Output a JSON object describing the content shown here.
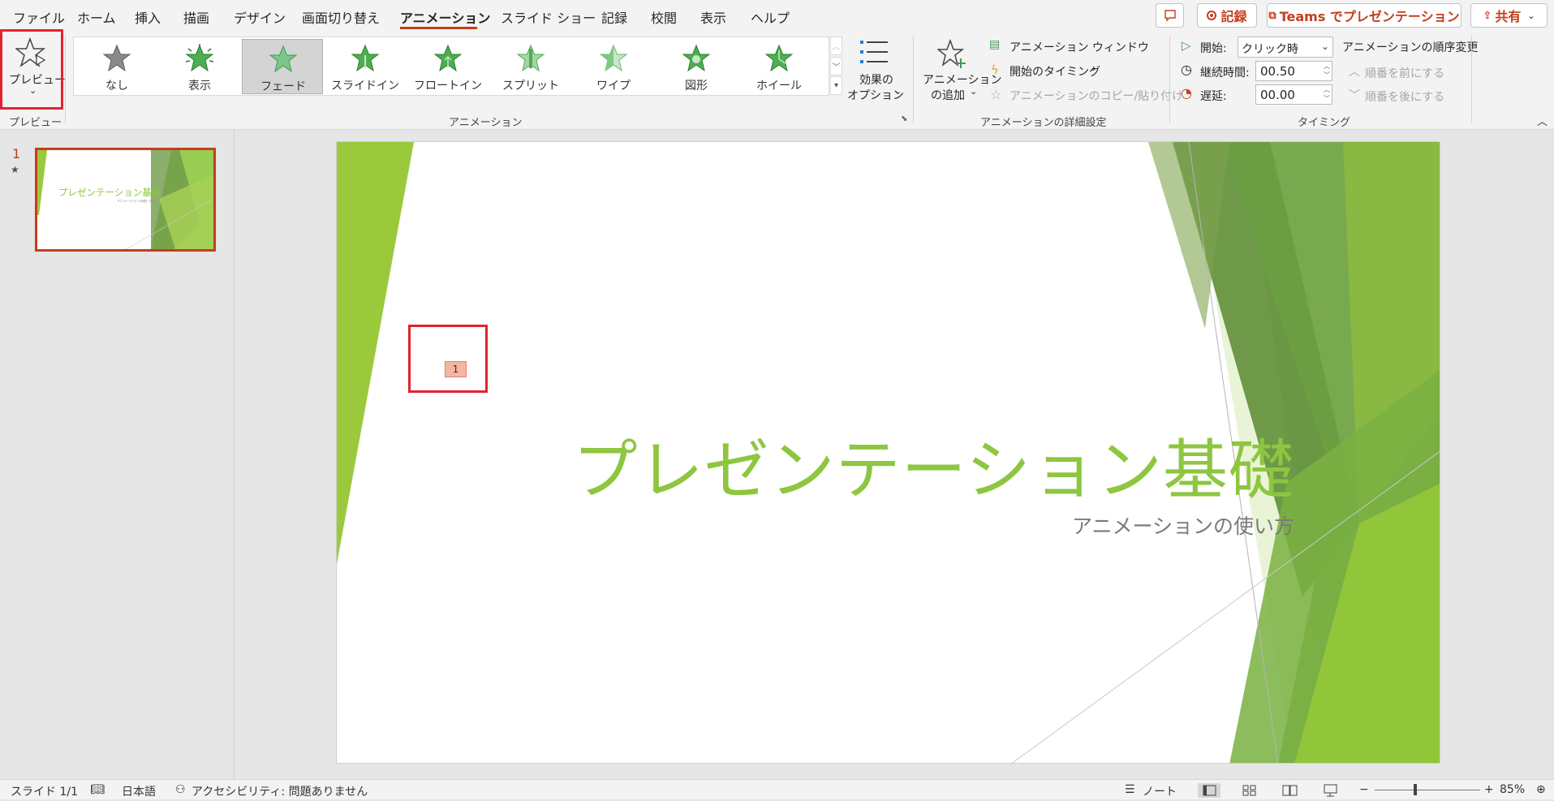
{
  "menu": {
    "tabs": [
      "ファイル",
      "ホーム",
      "挿入",
      "描画",
      "デザイン",
      "画面切り替え",
      "アニメーション",
      "スライド ショー",
      "記録",
      "校閲",
      "表示",
      "ヘルプ"
    ],
    "active_tab": "アニメーション"
  },
  "top_buttons": {
    "record": "記録",
    "teams": "Teams でプレゼンテーション",
    "share": "共有"
  },
  "ribbon": {
    "preview": {
      "label": "プレビュー",
      "group": "プレビュー"
    },
    "gallery": {
      "group": "アニメーション",
      "items": [
        "なし",
        "表示",
        "フェード",
        "スライドイン",
        "フロートイン",
        "スプリット",
        "ワイプ",
        "図形",
        "ホイール"
      ],
      "selected": "フェード"
    },
    "effect_options": {
      "line1": "効果の",
      "line2": "オプション"
    },
    "advanced": {
      "group": "アニメーションの詳細設定",
      "add_line1": "アニメーション",
      "add_line2": "の追加",
      "pane": "アニメーション ウィンドウ",
      "trigger": "開始のタイミング",
      "painter": "アニメーションのコピー/貼り付け"
    },
    "timing": {
      "group": "タイミング",
      "start_label": "開始:",
      "start_value": "クリック時",
      "duration_label": "継続時間:",
      "duration_value": "00.50",
      "delay_label": "遅延:",
      "delay_value": "00.00",
      "reorder_title": "アニメーションの順序変更",
      "move_earlier": "順番を前にする",
      "move_later": "順番を後にする"
    }
  },
  "slides_pane": {
    "slide_number": "1",
    "thumb_title": "プレゼンテーション基礎"
  },
  "slide": {
    "title": "プレゼンテーション基礎",
    "subtitle": "アニメーションの使い方",
    "animation_tag": "1"
  },
  "status": {
    "slide": "スライド 1/1",
    "language": "日本語",
    "accessibility": "アクセシビリティ: 問題ありません",
    "notes": "ノート",
    "zoom": "85%",
    "zoom_minus": "−",
    "zoom_plus": "+"
  },
  "colors": {
    "accent": "#c43e1c",
    "title_green": "#8dc63f",
    "highlight_box": "#e0242f"
  }
}
